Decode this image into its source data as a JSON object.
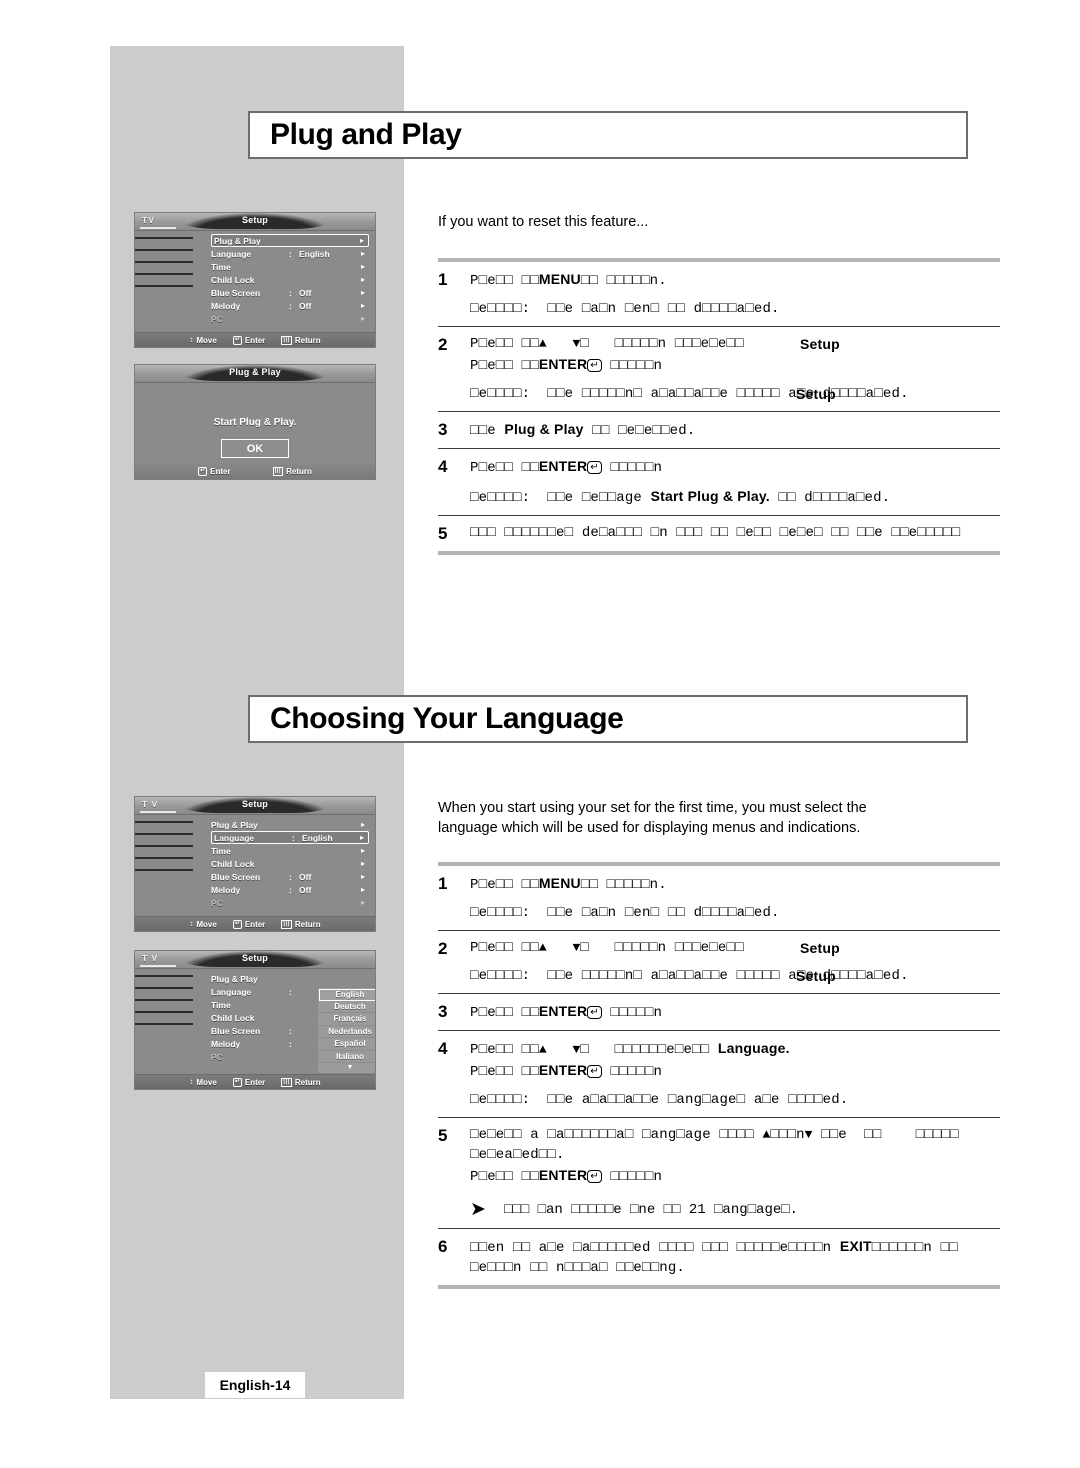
{
  "page": {
    "footer_label": "English-14",
    "background_color": "#ffffff",
    "sidebar_color": "#cccccc"
  },
  "sections": [
    {
      "id": "plug-and-play",
      "heading": "Plug and Play",
      "intro": "If you want to reset this feature...",
      "steps": [
        {
          "num": "1",
          "lines": [
            "P□e□□ □□MENU□□ □□□□□n."
          ],
          "note": "□e□□□□:  □□e □a□n □en□ □□ d□□□□a□ed.",
          "bold_tokens": [
            "MENU"
          ]
        },
        {
          "num": "2",
          "lines": [
            "P□e□□ □□▲   ▼□   □□□□□n □□□e□e□□",
            "P□e□□ □□ENTER↵ □□□□□n"
          ],
          "overlay_label": "Setup",
          "note": "□e□□□□:  □□e □□□□□n□ a□a□□a□□e □□□□□ a□e d□□□□a□ed.",
          "note_overlay_label": "Setup",
          "bold_tokens": [
            "ENTER",
            "Setup"
          ]
        },
        {
          "num": "3",
          "lines": [
            "□□e Plug & Play □□ □e□e□□ed."
          ],
          "bold_tokens": [
            "Plug & Play"
          ]
        },
        {
          "num": "4",
          "lines": [
            "P□e□□ □□ENTER↵ □□□□□n"
          ],
          "note": "□e□□□□:  □□e □e□□age Start Plug & Play. □□ d□□□□a□ed.",
          "bold_tokens": [
            "ENTER",
            "Start Plug & Play."
          ]
        },
        {
          "num": "5",
          "lines": [
            "□□□ □□□□□□e□ de□a□□□ □n □□□ □□ □e□□ □e□e□ □□ □□e □□e□□□□□"
          ]
        }
      ]
    },
    {
      "id": "choosing-your-language",
      "heading": "Choosing Your Language",
      "intro": "When you start using your set for the first time, you must select the\nlanguage which will be used for displaying menus and indications.",
      "steps": [
        {
          "num": "1",
          "lines": [
            "P□e□□ □□MENU□□ □□□□□n."
          ],
          "note": "□e□□□□:  □□e □a□n □en□ □□ d□□□□a□ed.",
          "bold_tokens": [
            "MENU"
          ]
        },
        {
          "num": "2",
          "lines": [
            "P□e□□ □□▲   ▼□   □□□□□n □□□e□e□□"
          ],
          "overlay_label": "Setup",
          "note": "□e□□□□:  □□e □□□□□n□ a□a□□a□□e □□□□□ a□e d□□□□a□ed.",
          "note_overlay_label": "Setup",
          "bold_tokens": [
            "Setup"
          ]
        },
        {
          "num": "3",
          "lines": [
            "P□e□□ □□ENTER↵ □□□□□n"
          ],
          "bold_tokens": [
            "ENTER"
          ]
        },
        {
          "num": "4",
          "lines": [
            "P□e□□ □□▲   ▼□   □□□□□□e□e□□ Language.",
            "P□e□□ □□ENTER↵ □□□□□n"
          ],
          "note": "□e□□□□:  □□e a□a□□a□□e □ang□age□ a□e □□□□ed.",
          "bold_tokens": [
            "ENTER",
            "Language."
          ]
        },
        {
          "num": "5",
          "lines": [
            "□e□e□□ a □a□□□□□□a□ □ang□age □□□□ □□e□□□ng □□e  □□    □□□□□",
            "□e□ea□ed□□.",
            "P□e□□ □□ENTER↵ □□□□□n"
          ],
          "tip": "□□□ □an □□□□□e □ne □□ 21 □ang□age□.",
          "bold_tokens": [
            "ENTER"
          ]
        },
        {
          "num": "6",
          "lines": [
            "□□en □□ a□e □a□□□□□ed □□□□ □□□ □□□□□e□□□n EXIT □□□□□n □□",
            "□e□□□n □□ n□□□a□ □□e□□ng."
          ],
          "bold_tokens": [
            "EXIT"
          ]
        }
      ]
    }
  ],
  "osd_menus": {
    "setup_plugplay_selected": {
      "tv_label": "TV",
      "tab_label": "Setup",
      "rows": [
        {
          "label": "Plug & Play",
          "colon": "",
          "value": "",
          "arrow": "▸",
          "selected": true,
          "dim": false
        },
        {
          "label": "Language",
          "colon": ":",
          "value": "English",
          "arrow": "▸",
          "selected": false,
          "dim": false
        },
        {
          "label": "Time",
          "colon": "",
          "value": "",
          "arrow": "▸",
          "selected": false,
          "dim": false
        },
        {
          "label": "Child Lock",
          "colon": "",
          "value": "",
          "arrow": "▸",
          "selected": false,
          "dim": false
        },
        {
          "label": "Blue Screen",
          "colon": ":",
          "value": "Off",
          "arrow": "▸",
          "selected": false,
          "dim": false
        },
        {
          "label": "Melody",
          "colon": ":",
          "value": "Off",
          "arrow": "▸",
          "selected": false,
          "dim": false
        },
        {
          "label": "PC",
          "colon": "",
          "value": "",
          "arrow": "▸",
          "selected": false,
          "dim": true
        }
      ],
      "footer": [
        {
          "icon": "updown-arrow-icon",
          "glyph": "↕",
          "label": "Move"
        },
        {
          "icon": "enter-key-icon",
          "glyph": "↵",
          "label": "Enter"
        },
        {
          "icon": "menu-key-icon",
          "glyph": "|||",
          "label": "Return"
        }
      ]
    },
    "plugplay_dialog": {
      "tab_label": "Plug & Play",
      "message": "Start Plug & Play.",
      "ok_label": "OK",
      "footer": [
        {
          "icon": "enter-key-icon",
          "glyph": "↵",
          "label": "Enter"
        },
        {
          "icon": "menu-key-icon",
          "glyph": "|||",
          "label": "Return"
        }
      ]
    },
    "setup_language_selected": {
      "tv_label": "T V",
      "tab_label": "Setup",
      "rows": [
        {
          "label": "Plug & Play",
          "colon": "",
          "value": "",
          "arrow": "▸",
          "selected": false,
          "dim": false
        },
        {
          "label": "Language",
          "colon": ":",
          "value": "English",
          "arrow": "▸",
          "selected": true,
          "dim": false
        },
        {
          "label": "Time",
          "colon": "",
          "value": "",
          "arrow": "▸",
          "selected": false,
          "dim": false
        },
        {
          "label": "Child Lock",
          "colon": "",
          "value": "",
          "arrow": "▸",
          "selected": false,
          "dim": false
        },
        {
          "label": "Blue Screen",
          "colon": ":",
          "value": "Off",
          "arrow": "▸",
          "selected": false,
          "dim": false
        },
        {
          "label": "Melody",
          "colon": ":",
          "value": "Off",
          "arrow": "▸",
          "selected": false,
          "dim": false
        },
        {
          "label": "PC",
          "colon": "",
          "value": "",
          "arrow": "▸",
          "selected": false,
          "dim": true
        }
      ],
      "footer": [
        {
          "icon": "updown-arrow-icon",
          "glyph": "↕",
          "label": "Move"
        },
        {
          "icon": "enter-key-icon",
          "glyph": "↵",
          "label": "Enter"
        },
        {
          "icon": "menu-key-icon",
          "glyph": "|||",
          "label": "Return"
        }
      ]
    },
    "setup_language_list": {
      "tv_label": "T V",
      "tab_label": "Setup",
      "rows": [
        {
          "label": "Plug & Play",
          "colon": "",
          "value": "",
          "arrow": "",
          "selected": false,
          "dim": false
        },
        {
          "label": "Language",
          "colon": ":",
          "value": "",
          "arrow": "",
          "selected": false,
          "dim": false
        },
        {
          "label": "Time",
          "colon": "",
          "value": "",
          "arrow": "",
          "selected": false,
          "dim": false
        },
        {
          "label": "Child Lock",
          "colon": "",
          "value": "",
          "arrow": "",
          "selected": false,
          "dim": false
        },
        {
          "label": "Blue Screen",
          "colon": ":",
          "value": "",
          "arrow": "",
          "selected": false,
          "dim": false
        },
        {
          "label": "Melody",
          "colon": ":",
          "value": "",
          "arrow": "",
          "selected": false,
          "dim": false
        },
        {
          "label": "PC",
          "colon": "",
          "value": "",
          "arrow": "",
          "selected": false,
          "dim": true
        }
      ],
      "language_options": [
        {
          "label": "English",
          "active": true
        },
        {
          "label": "Deutsch",
          "active": false
        },
        {
          "label": "Français",
          "active": false
        },
        {
          "label": "Nederlands",
          "active": false
        },
        {
          "label": "Español",
          "active": false
        },
        {
          "label": "Italiano",
          "active": false
        }
      ],
      "more_glyph": "▼",
      "footer": [
        {
          "icon": "updown-arrow-icon",
          "glyph": "↕",
          "label": "Move"
        },
        {
          "icon": "enter-key-icon",
          "glyph": "↵",
          "label": "Enter"
        },
        {
          "icon": "menu-key-icon",
          "glyph": "|||",
          "label": "Return"
        }
      ]
    }
  }
}
